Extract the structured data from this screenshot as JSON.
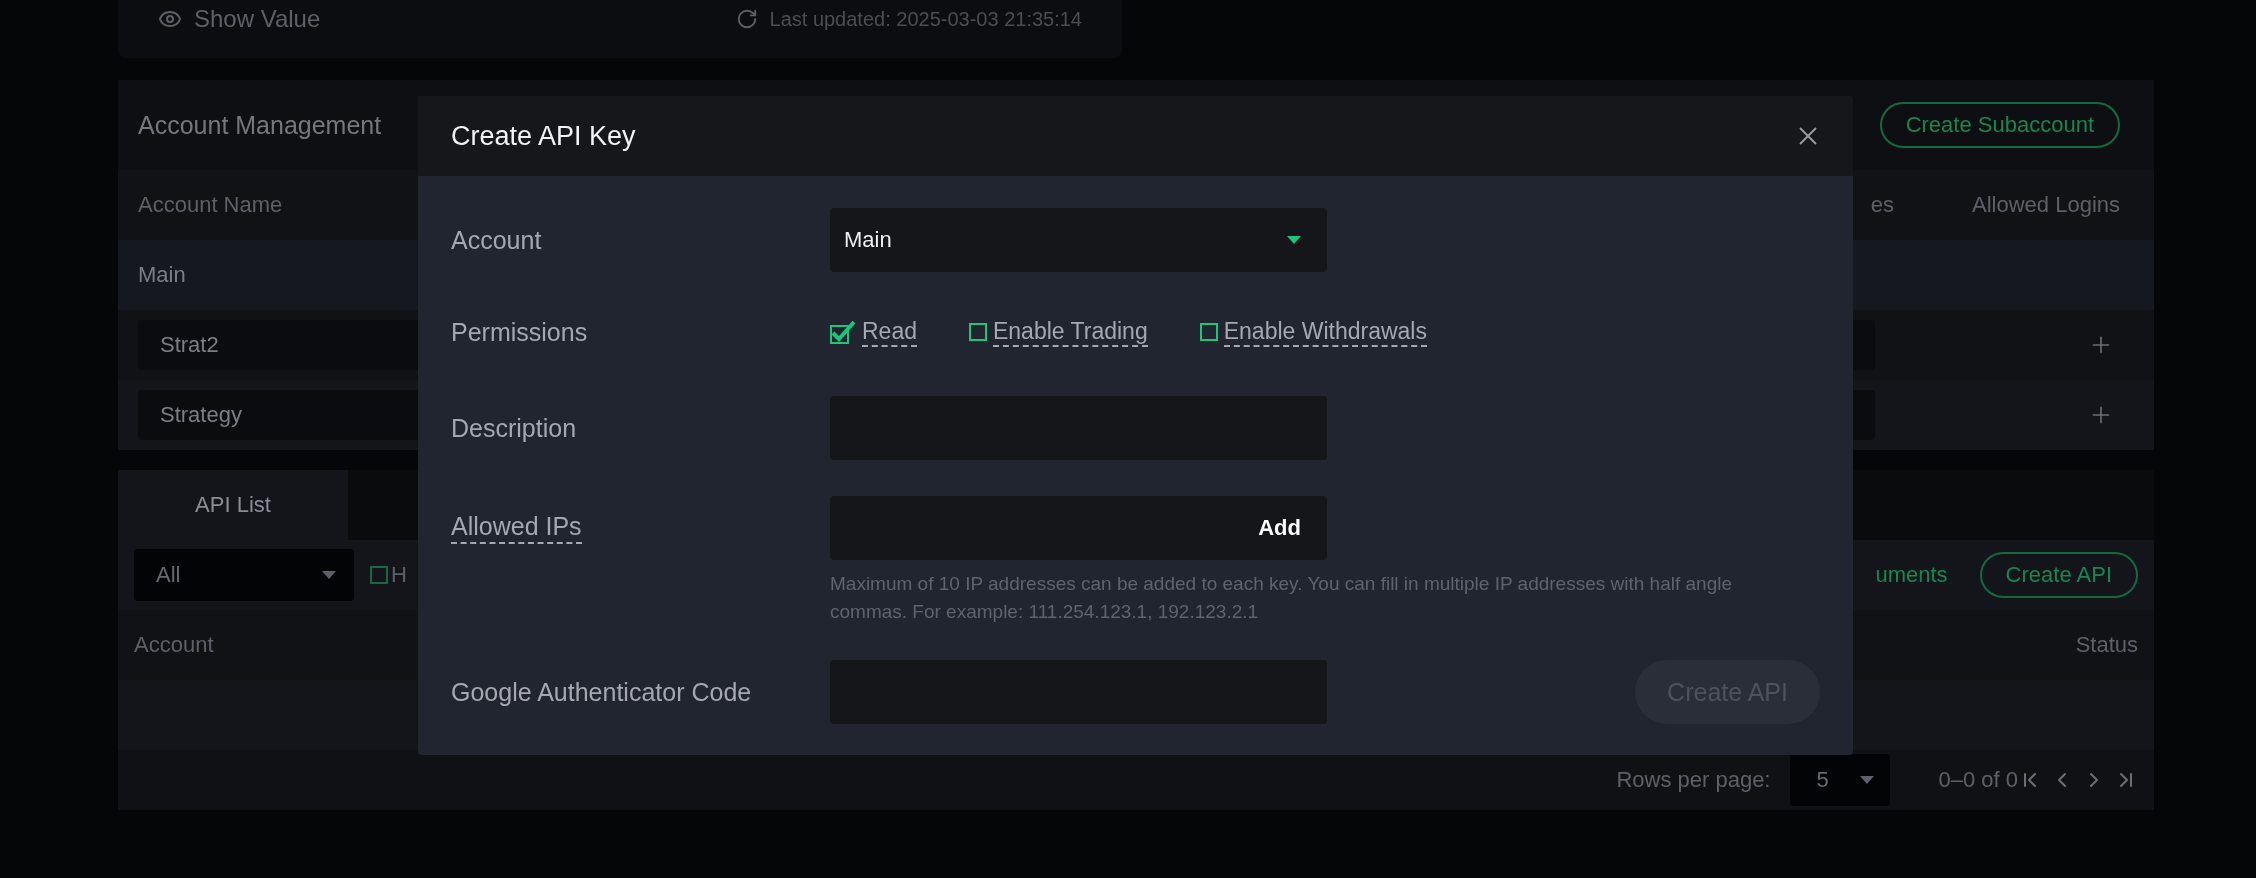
{
  "summary_card": {
    "show_value": "Show Value",
    "last_updated": "Last updated: 2025-03-03 21:35:14"
  },
  "account_management": {
    "title": "Account Management",
    "create_button": "Create Subaccount",
    "columns": [
      "Account Name",
      "es",
      "Allowed Logins"
    ],
    "rows": [
      {
        "name": "Main",
        "kind": "main"
      },
      {
        "name": "Strat2",
        "kind": "sub"
      },
      {
        "name": "Strategy",
        "kind": "sub"
      }
    ]
  },
  "api_panel": {
    "tabs": [
      {
        "label": "API List",
        "selected": true
      }
    ],
    "filter": {
      "value": "All"
    },
    "checkbox": {
      "label": "H",
      "checked": false
    },
    "docs_link": "uments",
    "create_button": "Create API",
    "columns": [
      "Account",
      "Status"
    ],
    "footer": {
      "rows_per_page_label": "Rows per page:",
      "rows_per_page": "5",
      "range": "0–0 of 0"
    }
  },
  "modal": {
    "title": "Create API Key",
    "fields": [
      {
        "kind": "select",
        "label": "Account",
        "value": "Main"
      },
      {
        "kind": "checkboxes",
        "label": "Permissions",
        "options": [
          {
            "label": "Read",
            "checked": true
          },
          {
            "label": "Enable Trading",
            "checked": false
          },
          {
            "label": "Enable Withdrawals",
            "checked": false
          }
        ]
      },
      {
        "kind": "input",
        "label": "Description"
      },
      {
        "kind": "ip_input",
        "label": "Allowed IPs",
        "action": "Add",
        "help": "Maximum of 10 IP addresses can be added to each key. You can fill in multiple IP addresses with half angle commas. For example: 111.254.123.1, 192.123.2.1"
      },
      {
        "kind": "input",
        "label": "Google Authenticator Code"
      }
    ],
    "submit": {
      "label": "Create API",
      "disabled": true
    }
  }
}
